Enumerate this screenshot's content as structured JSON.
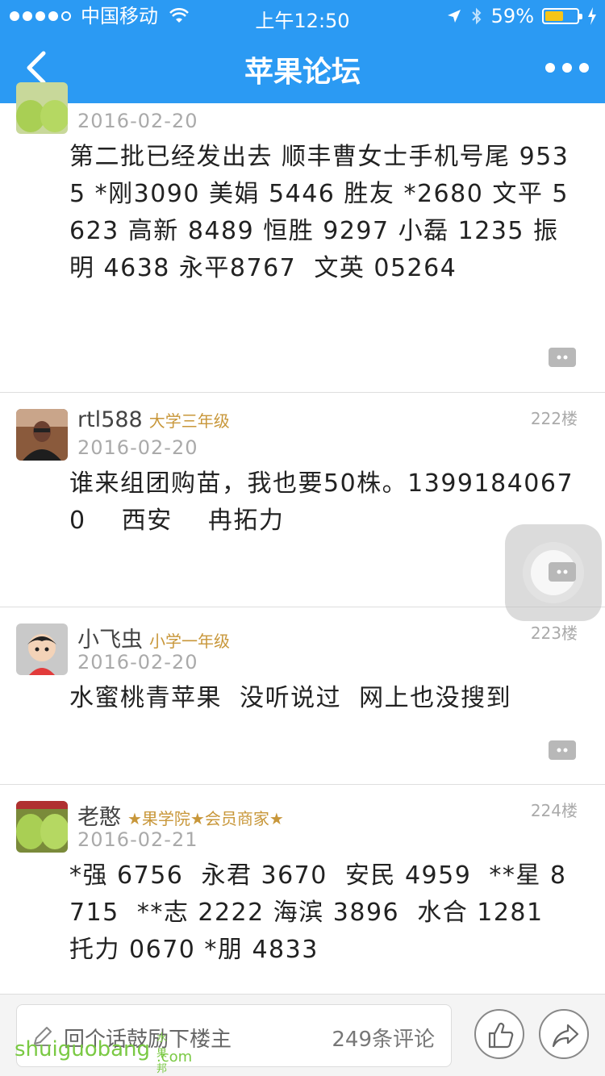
{
  "status_bar": {
    "carrier": "中国移动",
    "time": "上午12:50",
    "battery_text": "59%",
    "battery_level": 0.59,
    "icons": [
      "signal-dots-icon",
      "wifi-icon",
      "location-arrow-icon",
      "bluetooth-icon",
      "battery-icon",
      "charging-icon"
    ]
  },
  "nav": {
    "title": "苹果论坛",
    "back_icon": "chevron-left-icon",
    "more_icon": "more-dots-icon"
  },
  "posts": [
    {
      "username": "",
      "rank": "",
      "floor": "",
      "date": "2016-02-20",
      "content": "第二批已经发出去 顺丰曹女士手机号尾 9535 *刚3090 美娟 5446 胜友 *2680 文平 5623 高新 8489 恒胜 9297 小磊 1235 振明 4638 永平8767  文英 05264",
      "avatar": "apple-avatar"
    },
    {
      "username": "rtl588",
      "rank": "大学三年级",
      "floor": "222楼",
      "date": "2016-02-20",
      "content": "谁来组团购苗，我也要50株。13991840670    西安    冉拓力",
      "avatar": "man-photo-avatar"
    },
    {
      "username": "小飞虫",
      "rank": "小学一年级",
      "floor": "223楼",
      "date": "2016-02-20",
      "content": "水蜜桃青苹果  没听说过  网上也没搜到",
      "avatar": "cartoon-avatar"
    },
    {
      "username": "老憨",
      "rank": "★果学院★会员商家★",
      "floor": "224楼",
      "date": "2016-02-21",
      "content": "*强 6756  永君 3670  安民 4959  **星 8715  **志 2222 海滨 3896  水合 1281 托力 0670 *朋 4833",
      "avatar": "apple-avatar"
    }
  ],
  "bottom_bar": {
    "reply_placeholder": "回个话鼓励下楼主",
    "comment_count": "249条评论",
    "like_icon": "thumbs-up-icon",
    "share_icon": "share-arrow-icon"
  },
  "watermark": {
    "text": "shuiguobang",
    "sub": ".com",
    "small": "水果邦"
  },
  "colors": {
    "brand_blue": "#2b9af3",
    "rank_gold": "#c8973a",
    "date_gray": "#aaaaaa",
    "watermark_green": "#7ac943"
  }
}
